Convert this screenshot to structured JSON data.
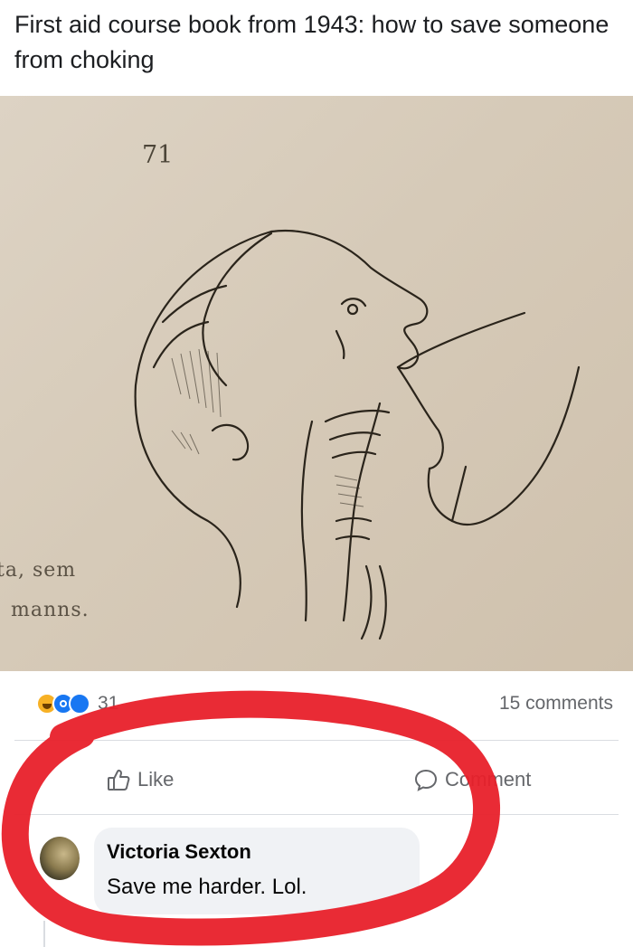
{
  "post": {
    "text": "First aid course book from 1943: how to save someone from choking"
  },
  "photo": {
    "page_number": "71",
    "book_text_line1": "ta,  sem",
    "book_text_line2": "manns."
  },
  "stats": {
    "reaction_icons": [
      "haha-reaction-icon",
      "like-reaction-icon",
      "love-reaction-icon"
    ],
    "reaction_count": "31",
    "comment_count": "15 comments"
  },
  "actions": {
    "like_label": "Like",
    "comment_label": "Comment"
  },
  "comment": {
    "author": "Victoria Sexton",
    "text": "Save me harder. Lol."
  },
  "colors": {
    "accent": "#1877f2",
    "highlight_marker": "#e8202a",
    "secondary_text": "#65676b",
    "bubble": "#f0f2f5"
  }
}
